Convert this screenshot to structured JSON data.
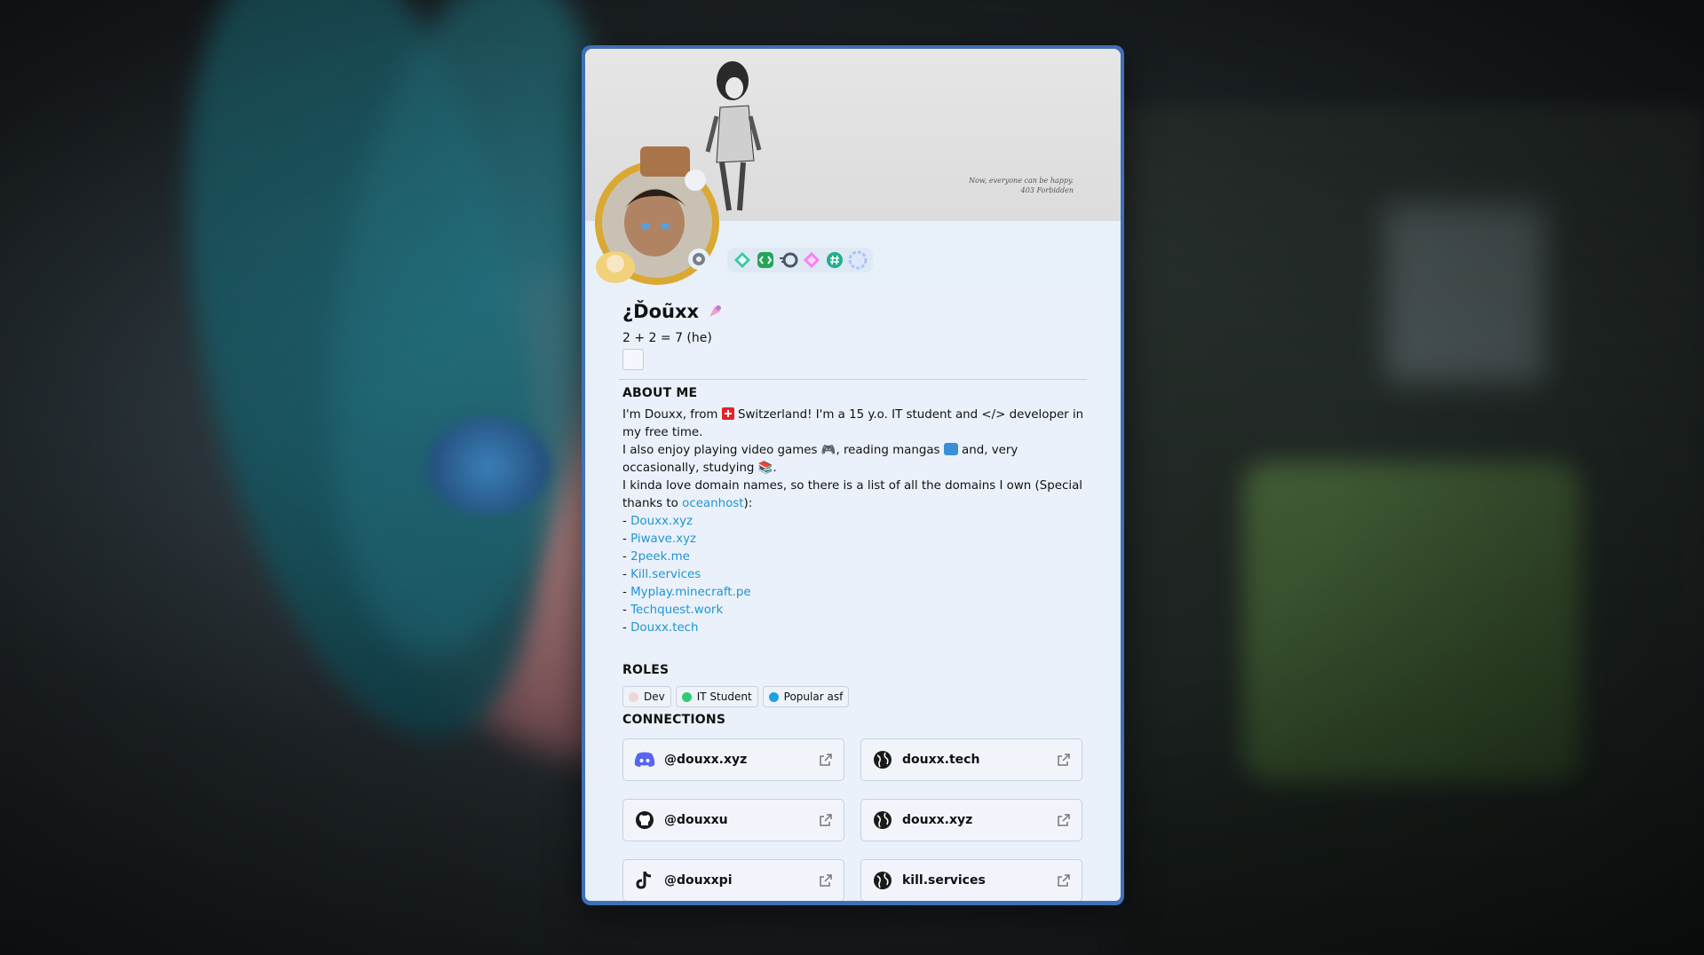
{
  "banner": {
    "caption_line1": "Now, everyone can be happy.",
    "caption_line2": "403 Forbidden"
  },
  "profile": {
    "display_name": "¿Ďoũxx",
    "pronouns": "2 + 2 = 7 (he)",
    "status_icon": "offline-status-icon"
  },
  "badges": [
    "hypesquad-balance-badge",
    "active-developer-badge",
    "quest-badge",
    "nitro-badge",
    "hashtag-badge",
    "boost-badge"
  ],
  "about": {
    "title": "ABOUT ME",
    "line1a": "I'm Douxx, from",
    "line1b": "Switzerland! I'm a 15 y.o. IT student and </> developer in my free time.",
    "line2a": "I also enjoy playing video games",
    "line2b": ", reading mangas",
    "line2c": "and, very occasionally, studying",
    "line2d": ".",
    "line3": "I kinda love domain names, so there is a list of all the domains I own (Special thanks to",
    "thanks_link": "oceanhost",
    "line3_end": "):",
    "domains": [
      "Douxx.xyz",
      "Piwave.xyz",
      "2peek.me",
      "Kill.services",
      "Myplay.minecraft.pe",
      "Techquest.work",
      "Douxx.tech"
    ]
  },
  "roles": {
    "title": "ROLES",
    "items": [
      {
        "label": "Dev",
        "color": "#f0d6d2"
      },
      {
        "label": "IT Student",
        "color": "#2ecc71"
      },
      {
        "label": "Popular asf",
        "color": "#1ea0e6"
      }
    ]
  },
  "connections": {
    "title": "CONNECTIONS",
    "items": [
      {
        "label": "@douxx.xyz",
        "icon": "discord-icon"
      },
      {
        "label": "douxx.tech",
        "icon": "globe-icon"
      },
      {
        "label": "@douxxu",
        "icon": "github-icon"
      },
      {
        "label": "douxx.xyz",
        "icon": "globe-icon"
      },
      {
        "label": "@douxxpi",
        "icon": "tiktok-icon"
      },
      {
        "label": "kill.services",
        "icon": "globe-icon"
      }
    ]
  },
  "colors": {
    "card_border": "#3f6fb6",
    "link": "#1e95d4",
    "panel": "#ebf1fa"
  }
}
